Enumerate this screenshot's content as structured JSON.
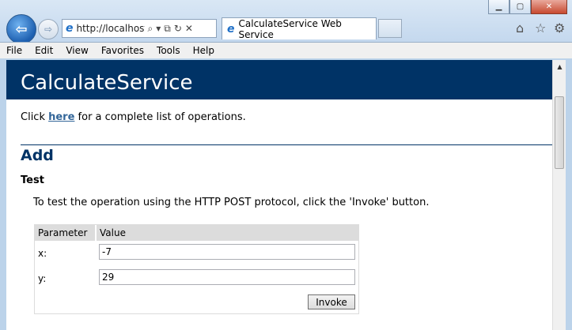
{
  "browser": {
    "address_url": "http://localhost:",
    "tab_title": "CalculateService Web Service"
  },
  "menu": [
    "File",
    "Edit",
    "View",
    "Favorites",
    "Tools",
    "Help"
  ],
  "page": {
    "service_name": "CalculateService",
    "intro_prefix": "Click ",
    "intro_link": "here",
    "intro_suffix": " for a complete list of operations.",
    "operation": "Add",
    "test_heading": "Test",
    "test_desc": "To test the operation using the HTTP POST protocol, click the 'Invoke' button.",
    "table": {
      "col_param": "Parameter",
      "col_value": "Value",
      "rows": [
        {
          "label": "x:",
          "value": "-7"
        },
        {
          "label": "y:",
          "value": "29"
        }
      ]
    },
    "invoke_label": "Invoke"
  }
}
